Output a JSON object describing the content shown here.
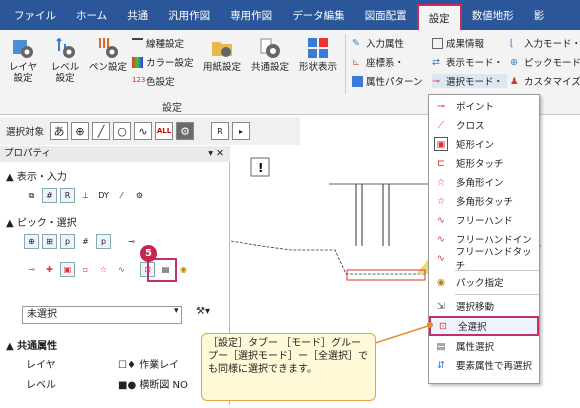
{
  "tabs": [
    "ファイル",
    "ホーム",
    "共通",
    "汎用作図",
    "専用作図",
    "データ編集",
    "図面配置",
    "設定",
    "数値地形",
    "影"
  ],
  "ribbon": {
    "big_buttons": [
      {
        "line1": "レイヤ",
        "line2": "設定"
      },
      {
        "line1": "レベル",
        "line2": "設定"
      },
      {
        "line1": "ペン設定",
        "line2": ""
      },
      {
        "line1": "用紙設定",
        "line2": ""
      },
      {
        "line1": "共通設定",
        "line2": ""
      },
      {
        "line1": "形状表示",
        "line2": ""
      }
    ],
    "small_col1": [
      "線種設定",
      "カラー設定",
      "色設定"
    ],
    "small_col2": [
      "入力属性",
      "座標系・",
      "属性パターン"
    ],
    "small_col3": [
      "成果情報",
      "表示モード・",
      "選択モード・"
    ],
    "small_col4": [
      "入力モード・",
      "ピックモード・",
      "カスタマイズ"
    ],
    "group_label": "設定"
  },
  "select_bar": {
    "label": "選択対象",
    "char_a": "あ",
    "all": "ALL",
    "r": "R"
  },
  "panel": {
    "title": "プロパティ",
    "section1": "表示・入力",
    "section2": "ピック・選択",
    "step_number": "5",
    "selection": "未選択",
    "section3": "共通属性",
    "row1_label": "レイヤ",
    "row1_value": "作業レイ",
    "row2_label": "レベル",
    "row2_value": "横断図 NO"
  },
  "menu_items": [
    "ポイント",
    "クロス",
    "矩形イン",
    "矩形タッチ",
    "多角形イン",
    "多角形タッチ",
    "フリーハンド",
    "フリーハンドイン",
    "フリーハンドタッチ",
    "パック指定",
    "選択移動",
    "全選択",
    "属性選択",
    "要素属性で再選択"
  ],
  "callout": {
    "text": "［設定］タブー ［モード］グループー［選択モード］ー［全選択］でも同様に選択できます。"
  },
  "colors": {
    "ribbon_blue": "#2b579a",
    "highlight": "#c0306a",
    "callout_bg": "#fff9d8"
  }
}
